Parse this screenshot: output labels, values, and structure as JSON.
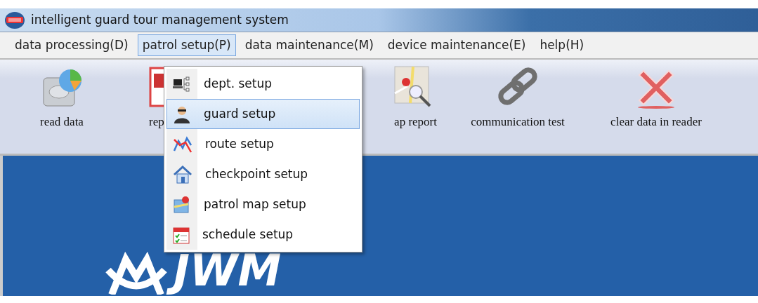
{
  "window": {
    "title": "intelligent guard tour management system"
  },
  "menu_bar": [
    {
      "label": "data processing(D)",
      "selected": false
    },
    {
      "label": "patrol setup(P)",
      "selected": true
    },
    {
      "label": "data maintenance(M)",
      "selected": false
    },
    {
      "label": "device maintenance(E)",
      "selected": false
    },
    {
      "label": "help(H)",
      "selected": false
    }
  ],
  "toolbar": [
    {
      "kind": "disk",
      "label": "read data"
    },
    {
      "kind": "report",
      "label": "rep"
    },
    {
      "kind": "map",
      "label": "ap report"
    },
    {
      "kind": "link",
      "label": "communication test"
    },
    {
      "kind": "clear",
      "label": "clear data in reader"
    }
  ],
  "dropdown": [
    {
      "kind": "dept",
      "label": "dept. setup",
      "selected": false
    },
    {
      "kind": "guard",
      "label": "guard setup",
      "selected": true
    },
    {
      "kind": "route",
      "label": "route setup",
      "selected": false
    },
    {
      "kind": "house",
      "label": "checkpoint setup",
      "selected": false
    },
    {
      "kind": "map",
      "label": "patrol map setup",
      "selected": false
    },
    {
      "kind": "calendar",
      "label": "schedule setup",
      "selected": false
    }
  ],
  "logo": {
    "text": "JWM"
  }
}
